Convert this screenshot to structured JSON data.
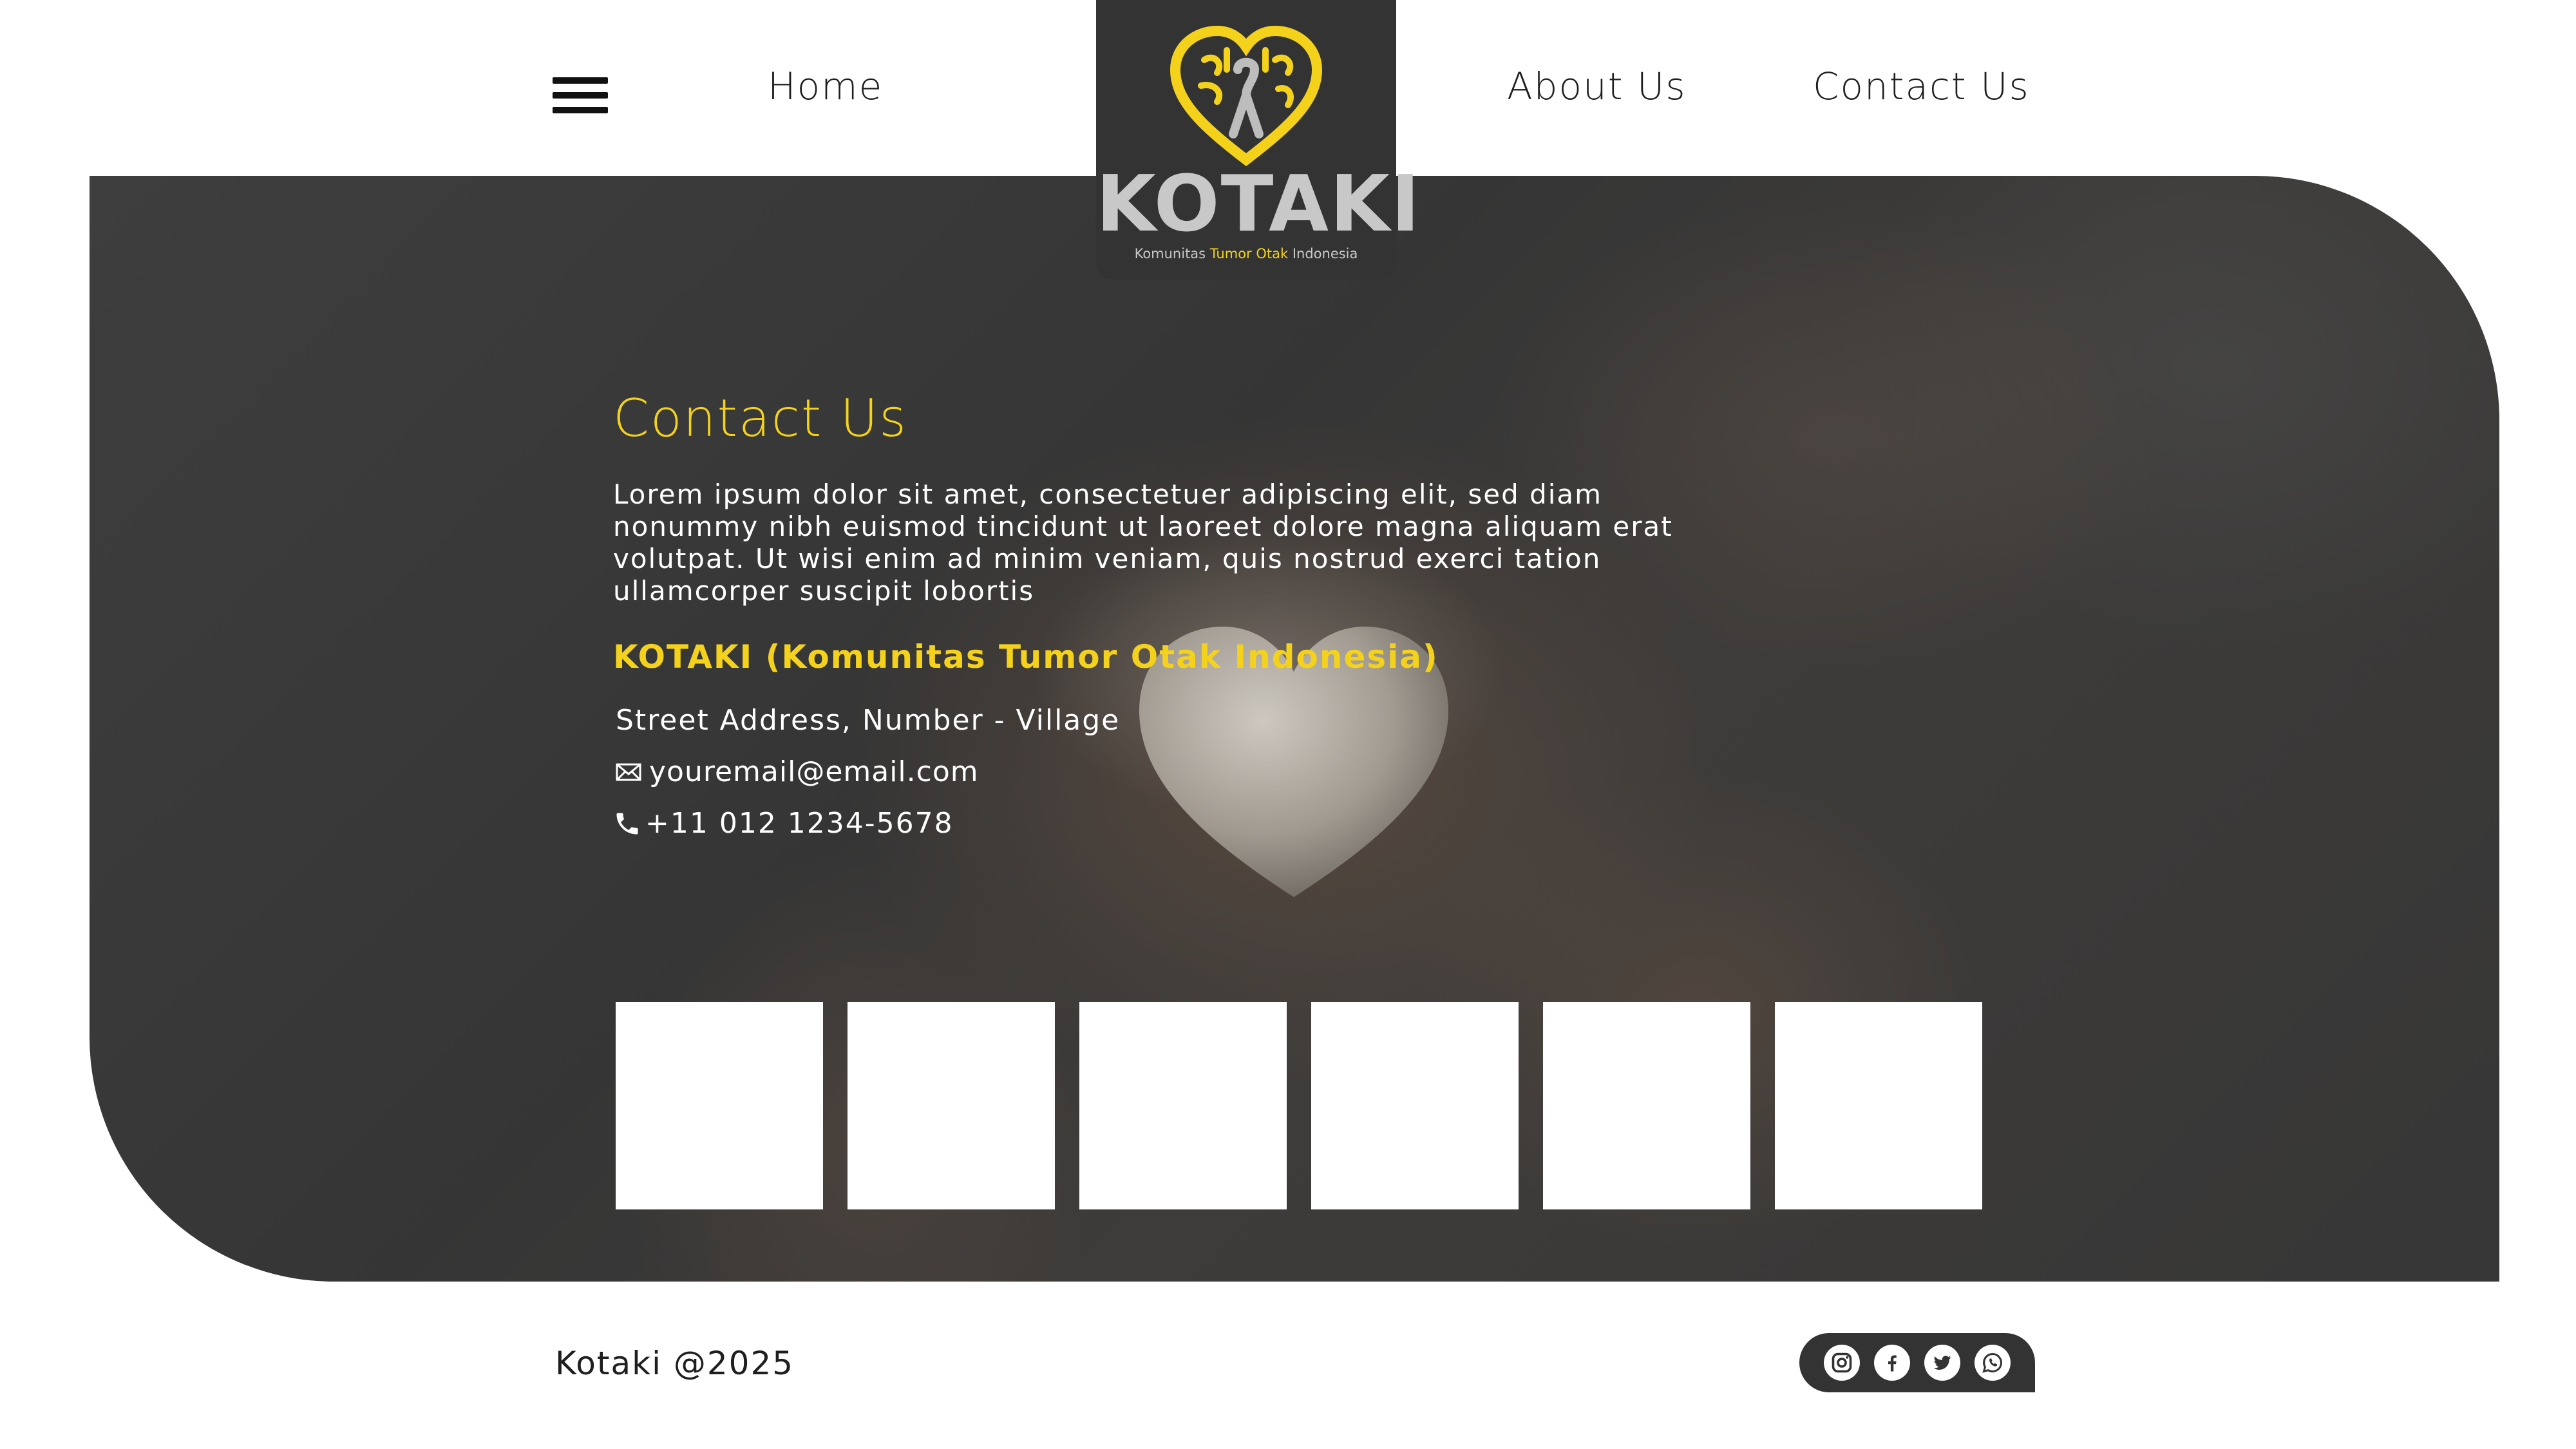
{
  "nav": {
    "menu_icon": "hamburger-menu-icon",
    "home": "Home",
    "about": "About Us",
    "contact": "Contact Us"
  },
  "logo": {
    "text": "KOTAKI",
    "subtitle_1": "Komunitas ",
    "subtitle_hl": "Tumor Otak",
    "subtitle_2": " Indonesia",
    "icon": "brain-heart-ribbon-icon"
  },
  "contact": {
    "title": "Contact Us",
    "description": "Lorem ipsum dolor sit amet, consectetuer adipiscing elit, sed diam nonummy nibh euismod tincidunt ut laoreet dolore magna aliquam erat volutpat. Ut wisi enim ad minim veniam, quis nostrud exerci tation ullamcorper suscipit lobortis",
    "org_name": "KOTAKI (Komunitas Tumor Otak Indonesia)",
    "address": "Street Address, Number - Village",
    "email": "youremail@email.com",
    "phone": "+11 012 1234-5678"
  },
  "gallery": {
    "count": 6
  },
  "footer": {
    "copyright": "Kotaki @2025",
    "social": [
      "instagram-icon",
      "facebook-icon",
      "twitter-icon",
      "whatsapp-icon"
    ]
  },
  "colors": {
    "accent": "#f4d21c",
    "dark": "#333333",
    "text": "#1e1e1e"
  }
}
